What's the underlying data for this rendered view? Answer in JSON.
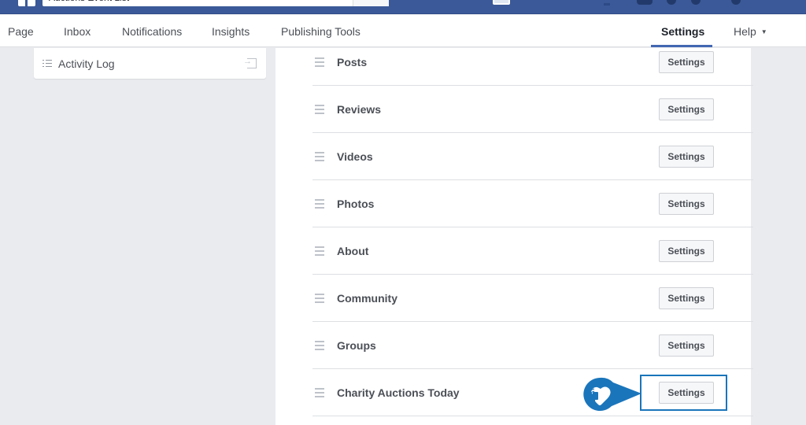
{
  "topbar": {
    "page_name": "Auctions Event List",
    "search_icon": "search-icon"
  },
  "tabs": [
    {
      "label": "Page",
      "active": false
    },
    {
      "label": "Inbox",
      "active": false
    },
    {
      "label": "Notifications",
      "active": false
    },
    {
      "label": "Insights",
      "active": false
    },
    {
      "label": "Publishing Tools",
      "active": false
    },
    {
      "label": "Settings",
      "active": true
    },
    {
      "label": "Help",
      "active": false,
      "dropdown": true
    }
  ],
  "sidebar": {
    "activity_log": "Activity Log"
  },
  "main": {
    "rows": [
      {
        "label": "Posts",
        "button": "Settings"
      },
      {
        "label": "Reviews",
        "button": "Settings"
      },
      {
        "label": "Videos",
        "button": "Settings"
      },
      {
        "label": "Photos",
        "button": "Settings"
      },
      {
        "label": "About",
        "button": "Settings"
      },
      {
        "label": "Community",
        "button": "Settings"
      },
      {
        "label": "Groups",
        "button": "Settings"
      },
      {
        "label": "Charity Auctions Today",
        "button": "Settings",
        "highlighted": true
      }
    ]
  },
  "colors": {
    "brand": "#3b5998",
    "highlight": "#1a75bb"
  }
}
